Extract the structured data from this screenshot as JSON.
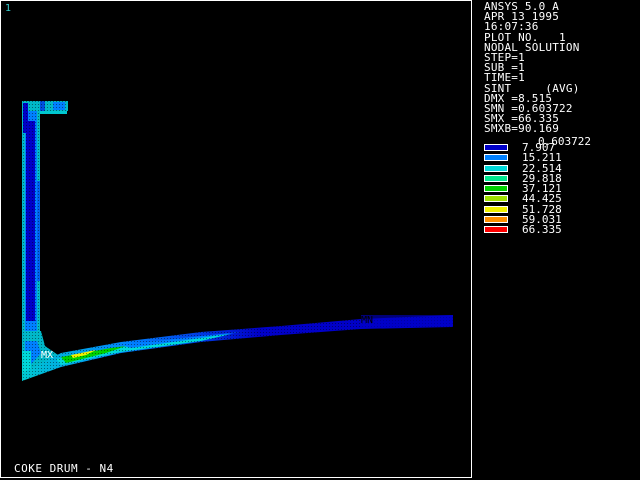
{
  "window_number": "1",
  "title": "COKE DRUM - N4",
  "info_lines": [
    "ANSYS 5.0 A",
    "APR 13 1995",
    "16:07:36",
    "PLOT NO.   1",
    "NODAL SOLUTION",
    "STEP=1",
    "SUB =1",
    "TIME=1",
    "SINT     (AVG)",
    "DMX =8.515",
    "SMN =0.603722",
    "SMX =66.335",
    "SMXB=90.169"
  ],
  "legend": {
    "min_label": "0.603722",
    "entries": [
      {
        "value": "7.907",
        "color": "#0000c8"
      },
      {
        "value": "15.211",
        "color": "#0080ff"
      },
      {
        "value": "22.514",
        "color": "#00d8d8"
      },
      {
        "value": "29.818",
        "color": "#00e890"
      },
      {
        "value": "37.121",
        "color": "#00d000"
      },
      {
        "value": "44.425",
        "color": "#a0e000"
      },
      {
        "value": "51.728",
        "color": "#f0f000"
      },
      {
        "value": "59.031",
        "color": "#ff9000"
      },
      {
        "value": "66.335",
        "color": "#ff0000"
      }
    ]
  },
  "markers": {
    "max_label": "MX",
    "min_label": "MN"
  },
  "colors": {
    "mesh_dark": "#0000c8",
    "mesh_mid": "#0080ff",
    "mesh_cyan": "#00d8d8",
    "mesh_green": "#00d000",
    "mesh_yellow": "#f0f000",
    "node_dots": "#000000",
    "outline": "#ffffff"
  }
}
